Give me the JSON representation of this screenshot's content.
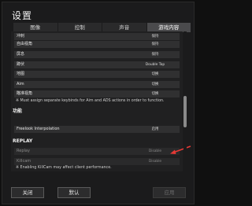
{
  "window": {
    "title": "设置"
  },
  "tabs": [
    {
      "label": "图像"
    },
    {
      "label": "控制"
    },
    {
      "label": "声音"
    },
    {
      "label": "游戏内容"
    }
  ],
  "rows": [
    {
      "label": "冲刺",
      "value": "保持"
    },
    {
      "label": "自由视角",
      "value": "保持"
    },
    {
      "label": "屏息",
      "value": "保持"
    },
    {
      "label": "蹲伏",
      "value": "Double Tap"
    },
    {
      "label": "地图",
      "value": "切换"
    },
    {
      "label": "Aim",
      "value": "切换"
    },
    {
      "label": "瞄准视角",
      "value": "切换"
    }
  ],
  "notes": {
    "aim_note": "※ Must assign separate keybinds for Aim and ADS actions in order to function.",
    "killcam_note": "※ Enabling KillCam may affect client performance."
  },
  "sections": {
    "function": "功能",
    "replay": "REPLAY"
  },
  "function_rows": [
    {
      "label": "Freelook Interpolation",
      "value": "启用"
    }
  ],
  "replay_rows": [
    {
      "label": "Replay",
      "value": "Disable"
    },
    {
      "label": "Killcam",
      "value": "Disable"
    }
  ],
  "footer": {
    "close": "关闭",
    "default": "默认",
    "apply": "应用"
  },
  "colors": {
    "annotation_arrow": "#e53935"
  }
}
